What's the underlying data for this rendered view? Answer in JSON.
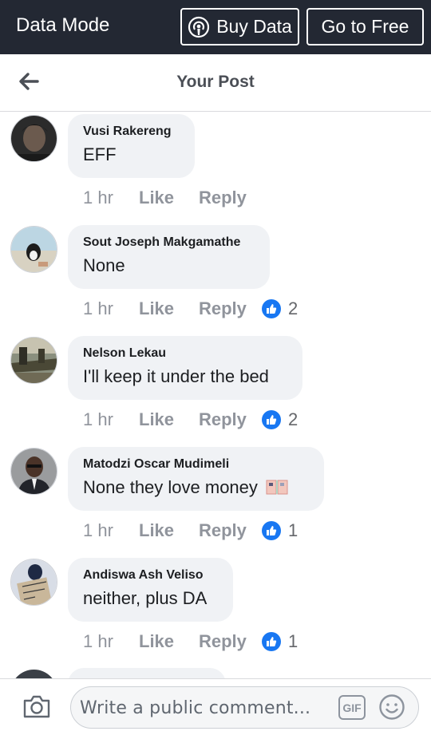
{
  "topbar": {
    "mode": "Data Mode",
    "buy_label": "Buy Data",
    "free_label": "Go to Free"
  },
  "header": {
    "title": "Your Post"
  },
  "comments": [
    {
      "name": "Vusi Rakereng",
      "text": "EFF",
      "time": "1 hr",
      "like": "Like",
      "reply": "Reply",
      "reactions": ""
    },
    {
      "name": "Sout Joseph Makgamathe",
      "text": "None",
      "time": "1 hr",
      "like": "Like",
      "reply": "Reply",
      "reactions": "2"
    },
    {
      "name": "Nelson Lekau",
      "text": "I'll keep it under the bed",
      "time": "1 hr",
      "like": "Like",
      "reply": "Reply",
      "reactions": "2"
    },
    {
      "name": "Matodzi Oscar Mudimeli",
      "text": "None they love money",
      "time": "1 hr",
      "like": "Like",
      "reply": "Reply",
      "reactions": "1"
    },
    {
      "name": "Andiswa Ash Veliso",
      "text": "neither, plus DA",
      "time": "1 hr",
      "like": "Like",
      "reply": "Reply",
      "reactions": "1"
    }
  ],
  "composer": {
    "placeholder": "Write a public comment...",
    "gif_label": "GIF"
  },
  "colors": {
    "topbar": "#232833",
    "bubble": "#f0f2f5",
    "like_blue": "#1877f2",
    "meta_grey": "#90949c"
  },
  "icons": [
    "hotspot-icon",
    "back-arrow-icon",
    "like-reaction-icon",
    "money-emoji-icon",
    "camera-icon",
    "gif-icon",
    "smiley-icon"
  ]
}
